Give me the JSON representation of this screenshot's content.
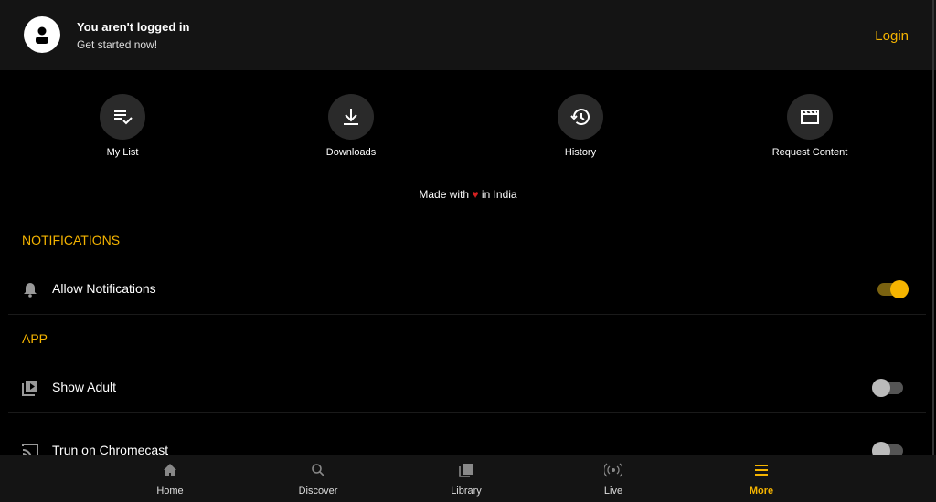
{
  "header": {
    "title": "You aren't logged in",
    "subtitle": "Get started now!",
    "login": "Login"
  },
  "quick_actions": [
    {
      "label": "My List",
      "icon": "playlist-check-icon"
    },
    {
      "label": "Downloads",
      "icon": "download-icon"
    },
    {
      "label": "History",
      "icon": "history-icon"
    },
    {
      "label": "Request Content",
      "icon": "clapperboard-icon"
    }
  ],
  "made": {
    "before": "Made with",
    "heart": "♥",
    "after": "in India"
  },
  "sections": {
    "notifications": "NOTIFICATIONS",
    "app": "APP"
  },
  "settings": [
    {
      "label": "Allow Notifications",
      "on": true
    },
    {
      "label": "Show Adult",
      "on": false
    },
    {
      "label": "Trun on Chromecast",
      "on": false
    }
  ],
  "nav": [
    {
      "label": "Home"
    },
    {
      "label": "Discover"
    },
    {
      "label": "Library"
    },
    {
      "label": "Live"
    },
    {
      "label": "More",
      "active": true
    }
  ],
  "colors": {
    "accent": "#f5b400",
    "header_bg": "#141414"
  }
}
